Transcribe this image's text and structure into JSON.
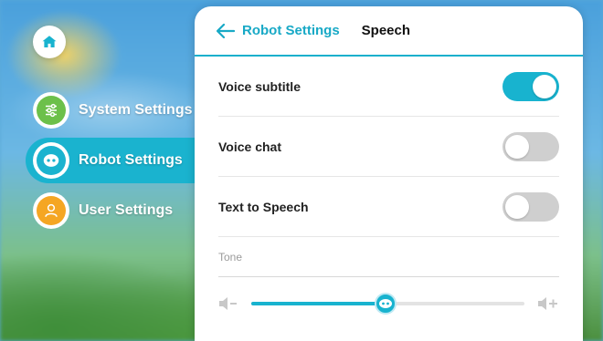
{
  "home": {
    "icon": "home-icon"
  },
  "sidebar": {
    "items": [
      {
        "label": "System Settings",
        "icon": "sliders-icon",
        "color": "#6cc04a",
        "active": false
      },
      {
        "label": "Robot Settings",
        "icon": "robot-icon",
        "color": "#1ab3cf",
        "active": true
      },
      {
        "label": "User Settings",
        "icon": "user-icon",
        "color": "#f5a623",
        "active": false
      }
    ]
  },
  "header": {
    "back_label": "Robot Settings",
    "title": "Speech"
  },
  "settings": [
    {
      "label": "Voice subtitle",
      "enabled": true
    },
    {
      "label": "Voice chat",
      "enabled": false
    },
    {
      "label": "Text to Speech",
      "enabled": false
    }
  ],
  "tone": {
    "label": "Tone",
    "value_fraction": 0.49,
    "min_icon": "volume-down-icon",
    "max_icon": "volume-up-icon"
  },
  "colors": {
    "accent": "#18b3cf",
    "toggle_off": "#cfcfcf"
  }
}
